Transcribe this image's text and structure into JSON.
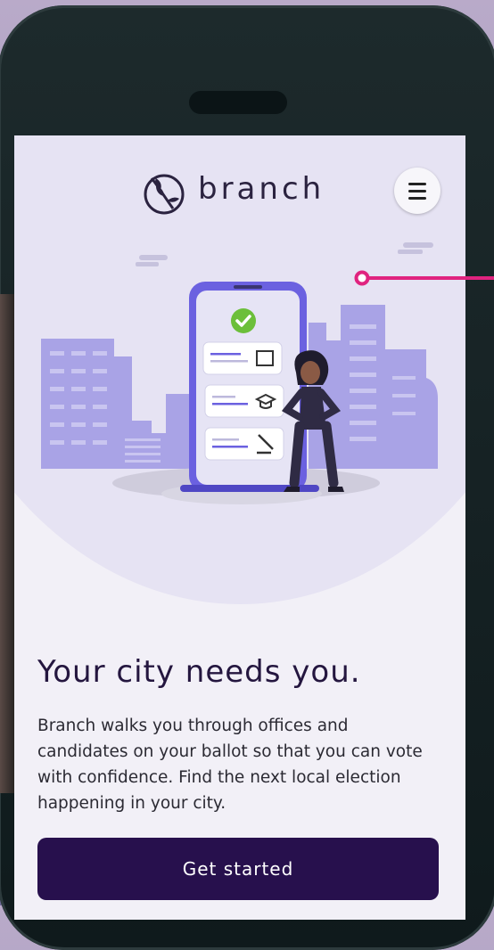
{
  "app": {
    "brand": "branch"
  },
  "header": {
    "menu_icon": "hamburger-menu-icon",
    "logo_icon": "olive-branch-logo-icon"
  },
  "hero": {
    "headline": "Your city needs you.",
    "body": "Branch walks you through offices and candidates on your ballot so that you can vote with confidence. Find the next local election happening in your city."
  },
  "cta": {
    "label": "Get started"
  },
  "colors": {
    "accent": "#27104d",
    "illustration_purple": "#6b61e0",
    "check_green": "#6cbf3a",
    "pointer_pink": "#e0237f"
  }
}
